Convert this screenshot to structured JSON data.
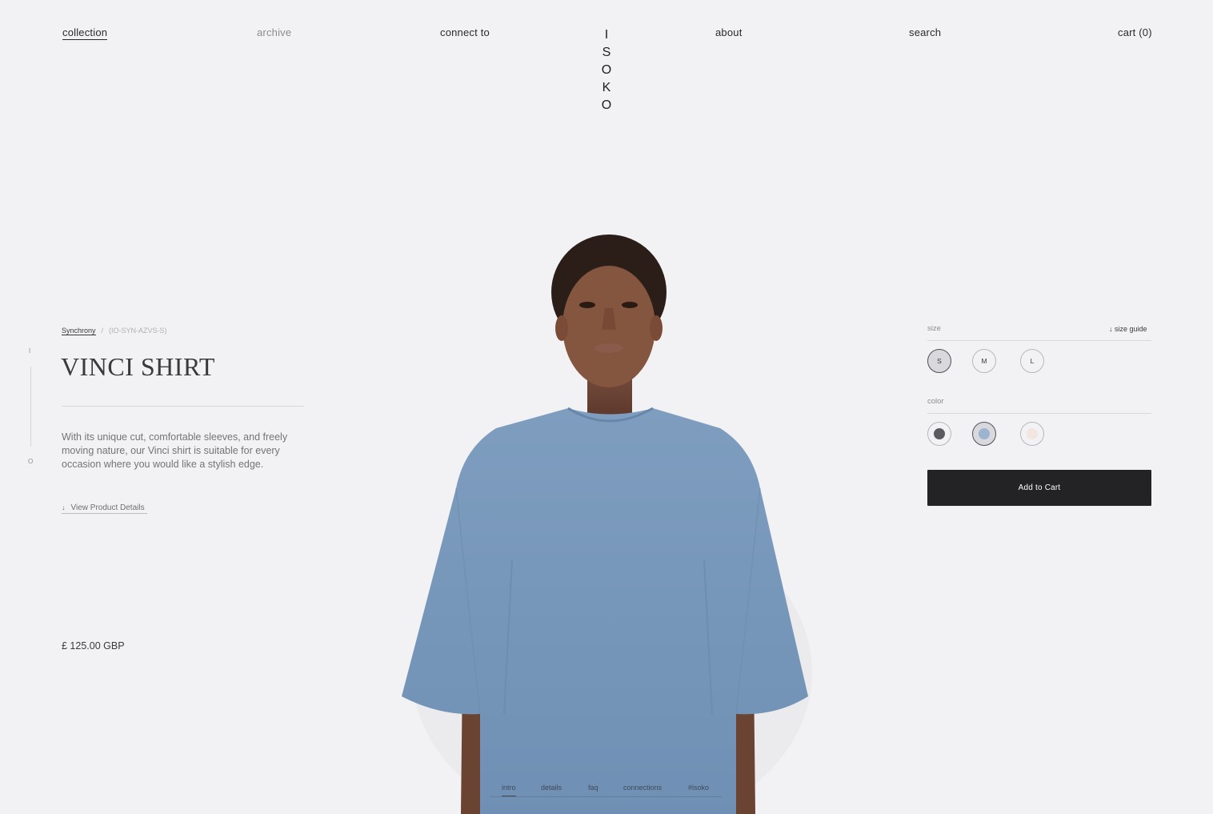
{
  "nav": {
    "collection": "collection",
    "archive": "archive",
    "connect": "connect to",
    "about": "about",
    "search": "search",
    "cart": "cart (0)"
  },
  "logo": {
    "letters": [
      "I",
      "S",
      "O",
      "K",
      "O"
    ]
  },
  "breadcrumb": {
    "collection": "Synchrony",
    "separator": "/",
    "sku": "(IO-SYN-AZVS-S)"
  },
  "product": {
    "title": "VINCI SHIRT",
    "description": "With its unique cut, comfortable sleeves, and freely moving nature, our Vinci shirt is suitable for every occasion where you would like a stylish edge.",
    "details_link": "View Product Details",
    "details_arrow": "↓",
    "price": "£ 125.00 GBP"
  },
  "slider": {
    "top": "I",
    "bottom": "O"
  },
  "options": {
    "size_label": "size",
    "size_guide": "↓ size guide",
    "sizes": [
      "S",
      "M",
      "L"
    ],
    "selected_size": "S",
    "color_label": "color",
    "colors": [
      "#5c5c60",
      "#9db4cf",
      "#f3e6e0"
    ],
    "selected_color": "#9db4cf"
  },
  "cart_button": "Add to Cart",
  "tabs": [
    "intro",
    "details",
    "faq",
    "connections",
    "#isoko"
  ],
  "active_tab": "intro"
}
